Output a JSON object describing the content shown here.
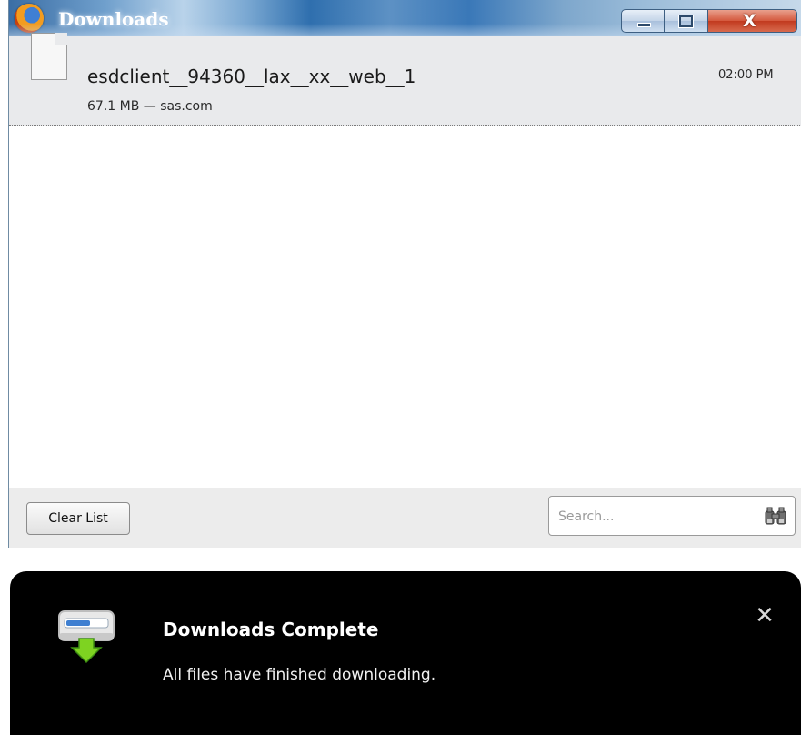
{
  "window": {
    "title": "Downloads",
    "controls": {
      "minimize": "minimize-icon",
      "maximize": "maximize-icon",
      "close": "X"
    }
  },
  "downloads": [
    {
      "filename": "esdclient__94360__lax__xx__web__1",
      "meta": "67.1 MB — sas.com",
      "time": "02:00 PM"
    }
  ],
  "footer": {
    "clear_button_label": "Clear List",
    "search_placeholder": "Search..."
  },
  "notification": {
    "title": "Downloads Complete",
    "body": "All files have finished downloading.",
    "close_glyph": "✕"
  },
  "colors": {
    "titlebar_accent": "#3a78b8",
    "close_button": "#d4583d",
    "notification_bg": "#000000",
    "download_arrow": "#7ed321"
  }
}
